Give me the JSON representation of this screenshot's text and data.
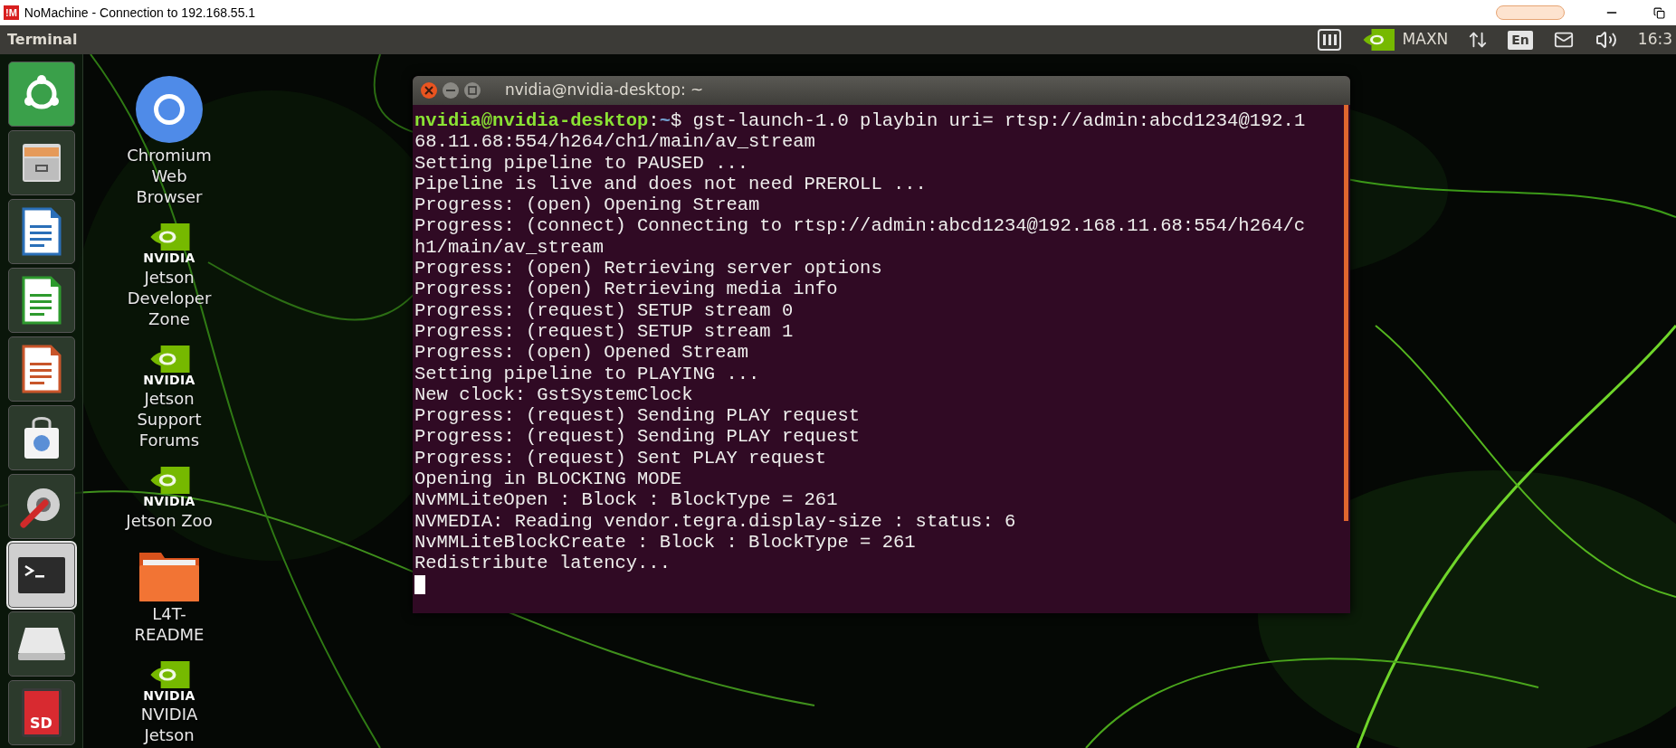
{
  "client_window": {
    "app_icon_text": "!M",
    "title": "NoMachine - Connection to 192.168.55.1"
  },
  "top_panel": {
    "title": "Terminal",
    "indicators": [
      {
        "kind": "nomachine"
      },
      {
        "kind": "nvidia",
        "label": "MAXN"
      },
      {
        "kind": "network"
      },
      {
        "kind": "keyboard",
        "label": "En"
      },
      {
        "kind": "mail"
      },
      {
        "kind": "volume"
      },
      {
        "kind": "clock",
        "label": "16:3"
      }
    ]
  },
  "launcher": [
    {
      "kind": "ubuntu",
      "selected": false
    },
    {
      "kind": "files",
      "selected": false
    },
    {
      "kind": "writer",
      "selected": false
    },
    {
      "kind": "calc",
      "selected": false
    },
    {
      "kind": "impress",
      "selected": false
    },
    {
      "kind": "software",
      "selected": false
    },
    {
      "kind": "settings",
      "selected": false
    },
    {
      "kind": "terminal",
      "selected": true
    },
    {
      "kind": "drive",
      "selected": false
    },
    {
      "kind": "sd",
      "label": "SD",
      "selected": false
    }
  ],
  "desktop_icons": [
    {
      "kind": "chromium",
      "label": "Chromium Web Browser"
    },
    {
      "kind": "nvidia",
      "logo_text": "NVIDIA",
      "label": "Jetson Developer Zone"
    },
    {
      "kind": "nvidia",
      "logo_text": "NVIDIA",
      "label": "Jetson Support Forums"
    },
    {
      "kind": "nvidia",
      "logo_text": "NVIDIA",
      "label": "Jetson Zoo"
    },
    {
      "kind": "folder",
      "label": "L4T-README"
    },
    {
      "kind": "nvidia",
      "logo_text": "NVIDIA",
      "label": "NVIDIA Jetson"
    }
  ],
  "terminal": {
    "title": "nvidia@nvidia-desktop: ~",
    "cursor_visible": true,
    "lines": [
      {
        "kind": "prompt",
        "user": "nvidia@nvidia-desktop",
        "separator": ":",
        "path": "~",
        "symbol": "$",
        "command": " gst-launch-1.0 playbin uri= rtsp://admin:abcd1234@192.1"
      },
      {
        "kind": "output",
        "text": "68.11.68:554/h264/ch1/main/av_stream"
      },
      {
        "kind": "output",
        "text": "Setting pipeline to PAUSED ..."
      },
      {
        "kind": "output",
        "text": "Pipeline is live and does not need PREROLL ..."
      },
      {
        "kind": "output",
        "text": "Progress: (open) Opening Stream"
      },
      {
        "kind": "output",
        "text": "Progress: (connect) Connecting to rtsp://admin:abcd1234@192.168.11.68:554/h264/c"
      },
      {
        "kind": "output",
        "text": "h1/main/av_stream"
      },
      {
        "kind": "output",
        "text": "Progress: (open) Retrieving server options"
      },
      {
        "kind": "output",
        "text": "Progress: (open) Retrieving media info"
      },
      {
        "kind": "output",
        "text": "Progress: (request) SETUP stream 0"
      },
      {
        "kind": "output",
        "text": "Progress: (request) SETUP stream 1"
      },
      {
        "kind": "output",
        "text": "Progress: (open) Opened Stream"
      },
      {
        "kind": "output",
        "text": "Setting pipeline to PLAYING ..."
      },
      {
        "kind": "output",
        "text": "New clock: GstSystemClock"
      },
      {
        "kind": "output",
        "text": "Progress: (request) Sending PLAY request"
      },
      {
        "kind": "output",
        "text": "Progress: (request) Sending PLAY request"
      },
      {
        "kind": "output",
        "text": "Progress: (request) Sent PLAY request"
      },
      {
        "kind": "output",
        "text": "Opening in BLOCKING MODE"
      },
      {
        "kind": "output",
        "text": "NvMMLiteOpen : Block : BlockType = 261"
      },
      {
        "kind": "output",
        "text": "NVMEDIA: Reading vendor.tegra.display-size : status: 6"
      },
      {
        "kind": "output",
        "text": "NvMMLiteBlockCreate : Block : BlockType = 261"
      },
      {
        "kind": "output",
        "text": "Redistribute latency..."
      }
    ]
  }
}
